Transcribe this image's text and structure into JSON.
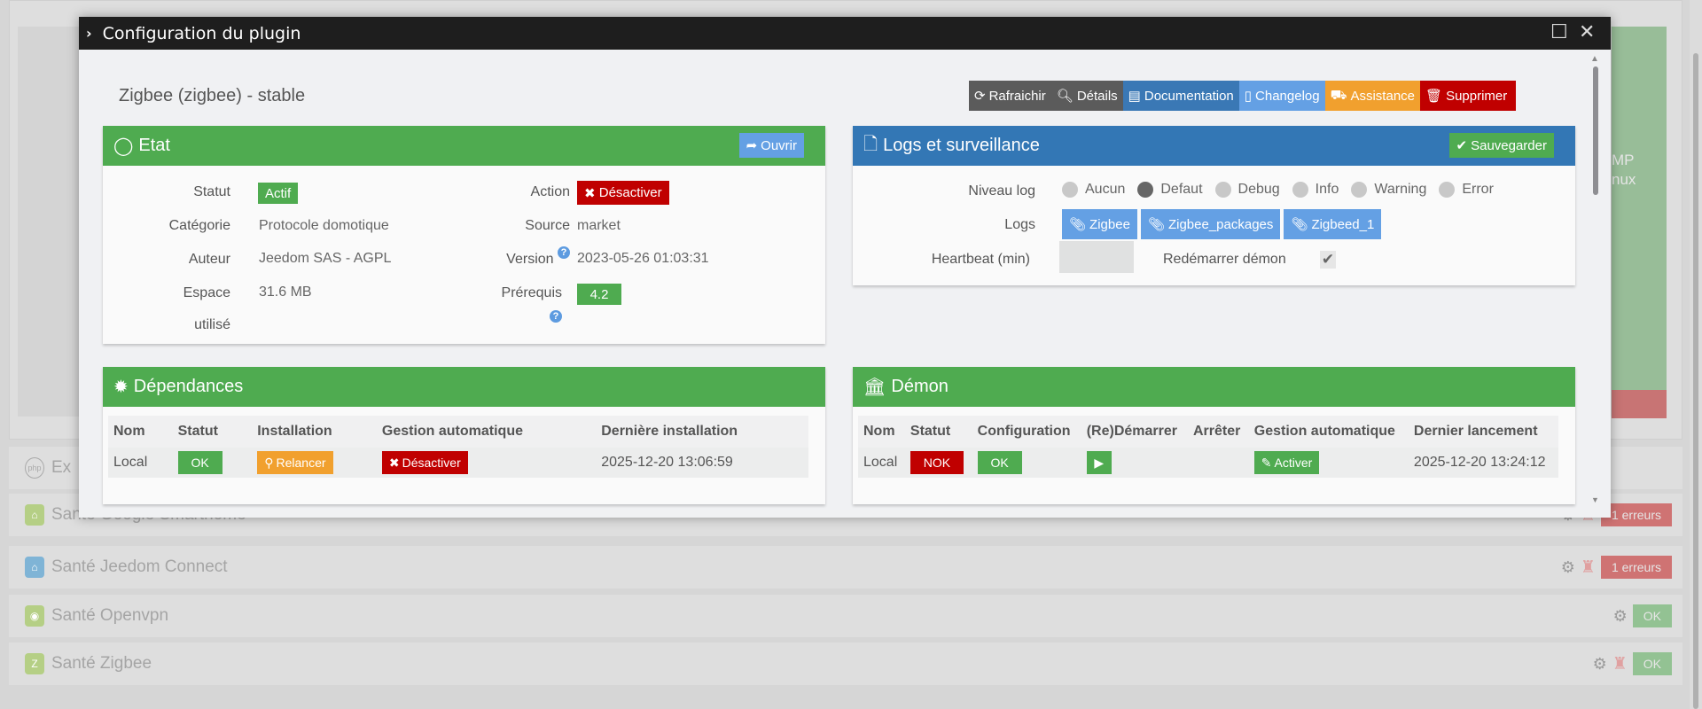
{
  "modal": {
    "title": "Configuration du plugin",
    "plugin_title": "Zigbee (zigbee) - stable"
  },
  "actions": [
    {
      "label": "Rafraichir",
      "icon": "refresh-icon",
      "color": "#5b5b5b"
    },
    {
      "label": "Détails",
      "icon": "search-icon",
      "color": "#5b5b5b"
    },
    {
      "label": "Documentation",
      "icon": "book-icon",
      "color": "#3a78b5"
    },
    {
      "label": "Changelog",
      "icon": "file-code-icon",
      "color": "#64a0e4"
    },
    {
      "label": "Assistance",
      "icon": "ambulance-icon",
      "color": "#f1a02e"
    },
    {
      "label": "Supprimer",
      "icon": "trash-icon",
      "color": "#c00000"
    }
  ],
  "etat": {
    "title": "Etat",
    "open": "Ouvrir",
    "statut_label": "Statut",
    "statut": "Actif",
    "categorie_label": "Catégorie",
    "categorie": "Protocole domotique",
    "auteur_label": "Auteur",
    "auteur": "Jeedom SAS - AGPL",
    "espace_label1": "Espace",
    "espace_label2": "utilisé",
    "espace": "31.6 MB",
    "action_label": "Action",
    "action": "Désactiver",
    "source_label": "Source",
    "source": "market",
    "version_label": "Version",
    "version": "2023-05-26 01:03:31",
    "prerequis_label": "Prérequis",
    "prerequis": "4.2",
    "help": "?"
  },
  "logs": {
    "title": "Logs et surveillance",
    "save": "Sauvegarder",
    "niveau_label": "Niveau log",
    "levels": [
      "Aucun",
      "Defaut",
      "Debug",
      "Info",
      "Warning",
      "Error"
    ],
    "selected_level": "Defaut",
    "logs_label": "Logs",
    "log_files": [
      "Zigbee",
      "Zigbee_packages",
      "Zigbeed_1"
    ],
    "heartbeat_label": "Heartbeat (min)",
    "heartbeat_value": "",
    "restart_label": "Redémarrer démon",
    "restart_checked": true
  },
  "deps": {
    "title": "Dépendances",
    "headers": [
      "Nom",
      "Statut",
      "Installation",
      "Gestion automatique",
      "Dernière installation"
    ],
    "row": {
      "nom": "Local",
      "statut": "OK",
      "installation": "Relancer",
      "gestion": "Désactiver",
      "date": "2025-12-20 13:06:59"
    }
  },
  "demon": {
    "title": "Démon",
    "headers": [
      "Nom",
      "Statut",
      "Configuration",
      "(Re)Démarrer",
      "Arrêter",
      "Gestion automatique",
      "Dernier lancement"
    ],
    "row": {
      "nom": "Local",
      "statut": "NOK",
      "config": "OK",
      "gestion": "Activer",
      "date": "2025-12-20 13:24:12"
    }
  },
  "background": {
    "panel_text1": "MP",
    "panel_text2": "nux",
    "rows": [
      {
        "label": "Ex",
        "icon": "php-icon",
        "status": ""
      },
      {
        "label": "Santé Google Smarthome",
        "icon": "google-home-icon",
        "status": "1 erreurs"
      },
      {
        "label": "Santé Jeedom Connect",
        "icon": "jeedom-connect-icon",
        "status": "1 erreurs"
      },
      {
        "label": "Santé Openvpn",
        "icon": "openvpn-icon",
        "status": "OK"
      },
      {
        "label": "Santé Zigbee",
        "icon": "zigbee-icon",
        "status": "OK"
      }
    ]
  }
}
